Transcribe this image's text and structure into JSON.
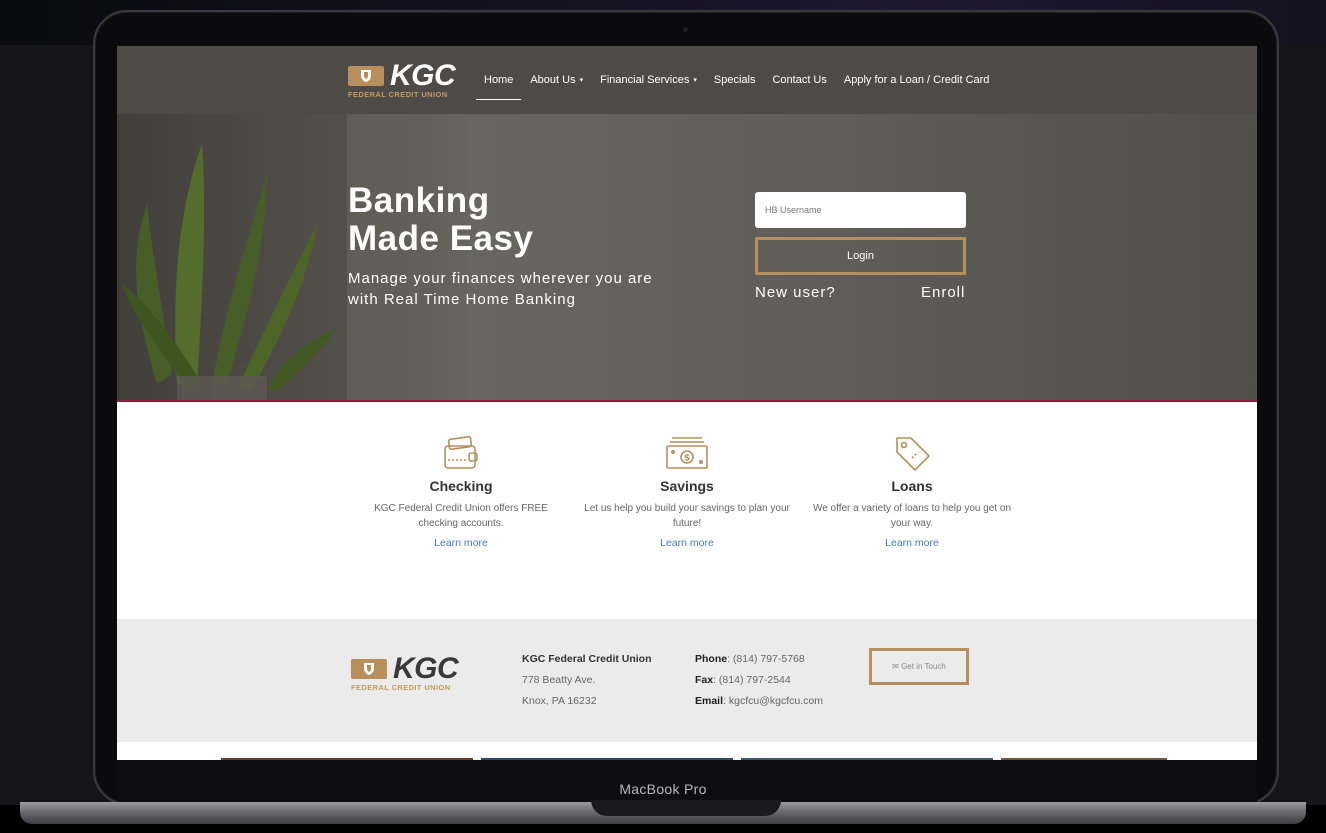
{
  "device": {
    "label": "MacBook Pro"
  },
  "nav": {
    "logo": {
      "name": "KGC",
      "subtitle": "FEDERAL CREDIT UNION"
    },
    "items": [
      {
        "label": "Home",
        "active": true,
        "dropdown": false
      },
      {
        "label": "About Us",
        "active": false,
        "dropdown": true
      },
      {
        "label": "Financial Services",
        "active": false,
        "dropdown": true
      },
      {
        "label": "Specials",
        "active": false,
        "dropdown": false
      },
      {
        "label": "Contact Us",
        "active": false,
        "dropdown": false
      },
      {
        "label": "Apply for a Loan / Credit Card",
        "active": false,
        "dropdown": false
      }
    ],
    "caret": "▾"
  },
  "hero": {
    "title_line1": "Banking",
    "title_line2": "Made Easy",
    "subtitle": "Manage your finances wherever you are with Real Time Home Banking",
    "login": {
      "username_placeholder": "HB Username",
      "login_label": "Login",
      "new_user_label": "New user?",
      "enroll_label": "Enroll"
    }
  },
  "features": [
    {
      "icon": "wallet-icon",
      "title": "Checking",
      "description": "KGC Federal Credit Union offers FREE checking accounts.",
      "link": "Learn more"
    },
    {
      "icon": "money-stack-icon",
      "title": "Savings",
      "description": "Let us help you build your savings to plan your future!",
      "link": "Learn more"
    },
    {
      "icon": "price-tag-icon",
      "title": "Loans",
      "description": "We offer a variety of loans to help you get on your way.",
      "link": "Learn more"
    }
  ],
  "footer": {
    "org_name": "KGC Federal Credit Union",
    "address_line1": "778 Beatty Ave.",
    "address_line2": "Knox, PA 16232",
    "phone_label": "Phone",
    "phone": ": (814) 797-5768",
    "fax_label": "Fax",
    "fax": ": (814) 797-2544",
    "email_label": "Email",
    "email": ": kgcfcu@kgcfcu.com",
    "cta_label": "Get in Touch",
    "cta_icon": "envelope-icon"
  },
  "colors": {
    "accent": "#b68f5d",
    "nav_bg": "#4e4a48",
    "hero_rule": "#8e1f3a",
    "link": "#4a7ab8"
  }
}
